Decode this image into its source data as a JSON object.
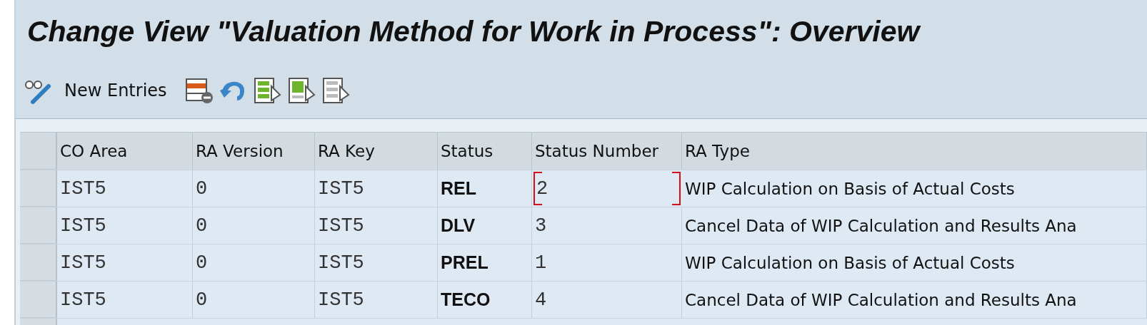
{
  "window": {
    "title": "Change View \"Valuation Method for Work in Process\": Overview"
  },
  "toolbar": {
    "items": [
      {
        "kind": "glasses-pencil"
      },
      {
        "kind": "text",
        "label": "New Entries"
      },
      {
        "kind": "delete-row"
      },
      {
        "kind": "undo"
      },
      {
        "kind": "select-all"
      },
      {
        "kind": "select-block"
      },
      {
        "kind": "deselect-all"
      }
    ]
  },
  "table": {
    "columns": [
      {
        "label": "CO Area",
        "kind": "mono"
      },
      {
        "label": "RA Version",
        "kind": "mono"
      },
      {
        "label": "RA Key",
        "kind": "mono"
      },
      {
        "label": "Status",
        "kind": "strong"
      },
      {
        "label": "Status Number",
        "kind": "mono"
      },
      {
        "label": "RA Type",
        "kind": "sans"
      }
    ],
    "rows": [
      {
        "cells": [
          "IST5",
          "0",
          "IST5",
          "REL",
          "2",
          "WIP Calculation on Basis of Actual Costs"
        ],
        "focused": true
      },
      {
        "cells": [
          "IST5",
          "0",
          "IST5",
          "DLV",
          "3",
          "Cancel Data of WIP Calculation and Results Ana"
        ],
        "focused": false
      },
      {
        "cells": [
          "IST5",
          "0",
          "IST5",
          "PREL",
          "1",
          "WIP Calculation on Basis of Actual Costs"
        ],
        "focused": false
      },
      {
        "cells": [
          "IST5",
          "0",
          "IST5",
          "TECO",
          "4",
          "Cancel Data of WIP Calculation and Results Ana"
        ],
        "focused": false
      }
    ]
  }
}
